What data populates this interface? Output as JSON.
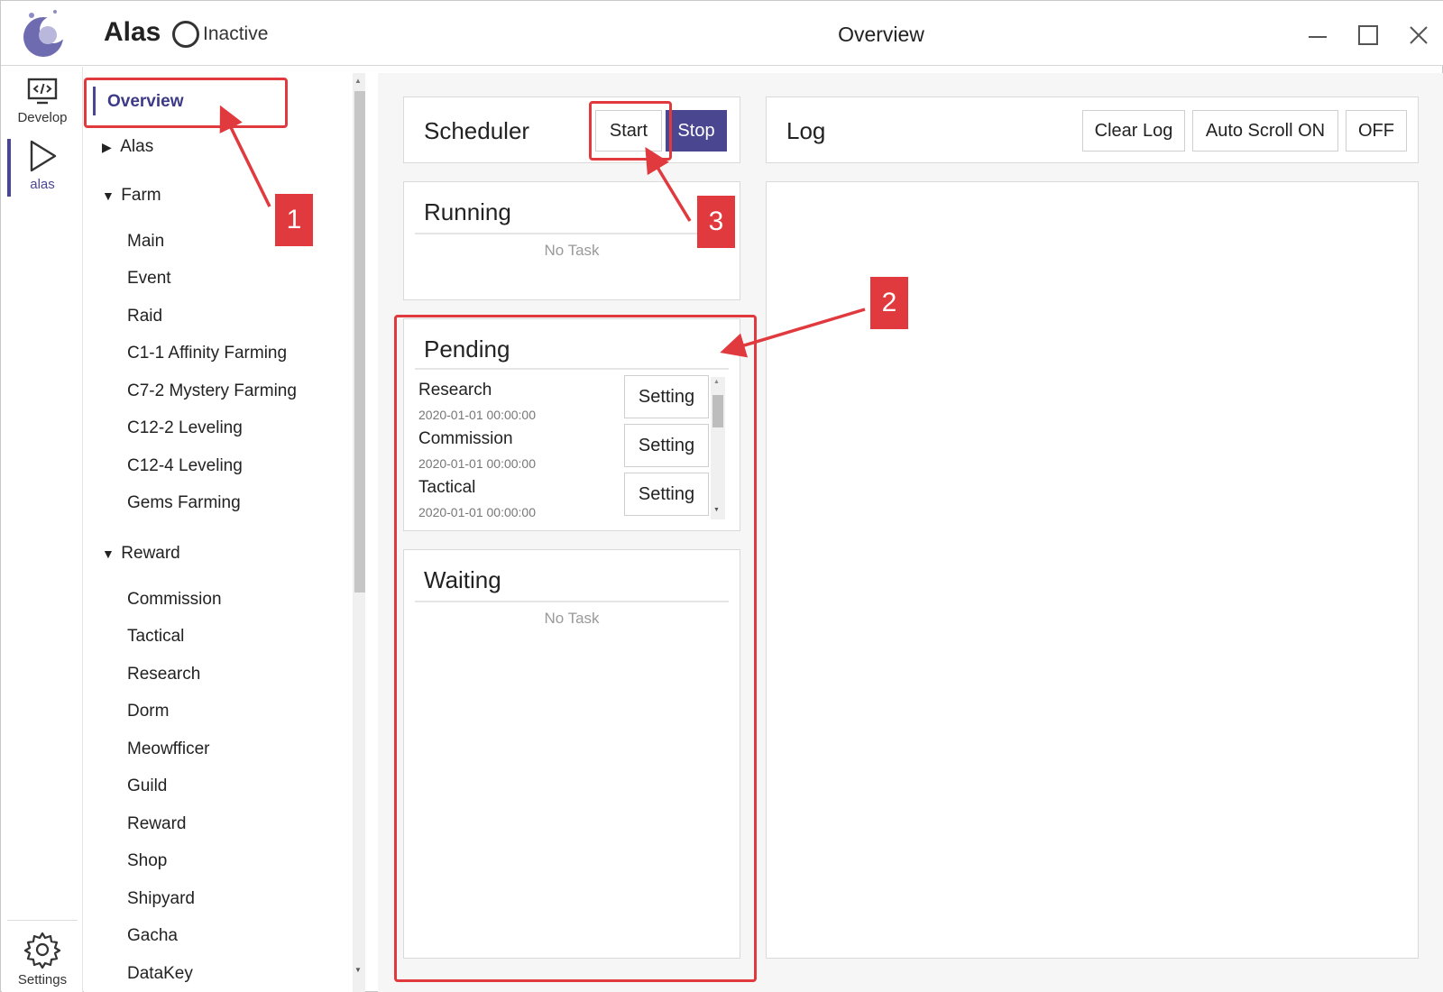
{
  "app": {
    "name": "Alas",
    "status": "Inactive",
    "window_title": "Overview"
  },
  "rail": {
    "develop": "Develop",
    "alas": "alas",
    "settings": "Settings"
  },
  "nav": {
    "overview": "Overview",
    "groups": [
      {
        "label": "Alas",
        "expanded": false
      },
      {
        "label": "Farm",
        "expanded": true
      },
      {
        "label": "Reward",
        "expanded": true
      }
    ],
    "farm_items": [
      "Main",
      "Event",
      "Raid",
      "C1-1 Affinity Farming",
      "C7-2 Mystery Farming",
      "C12-2 Leveling",
      "C12-4 Leveling",
      "Gems Farming"
    ],
    "reward_items": [
      "Commission",
      "Tactical",
      "Research",
      "Dorm",
      "Meowfficer",
      "Guild",
      "Reward",
      "Shop",
      "Shipyard",
      "Gacha",
      "DataKey"
    ]
  },
  "scheduler": {
    "title": "Scheduler",
    "start": "Start",
    "stop": "Stop"
  },
  "running": {
    "title": "Running",
    "empty": "No Task"
  },
  "pending": {
    "title": "Pending",
    "setting_label": "Setting",
    "tasks": [
      {
        "name": "Research",
        "time": "2020-01-01 00:00:00"
      },
      {
        "name": "Commission",
        "time": "2020-01-01 00:00:00"
      },
      {
        "name": "Tactical",
        "time": "2020-01-01 00:00:00"
      }
    ]
  },
  "waiting": {
    "title": "Waiting",
    "empty": "No Task"
  },
  "log": {
    "title": "Log",
    "clear": "Clear Log",
    "auto_scroll": "Auto Scroll ON",
    "off": "OFF"
  },
  "annotations": {
    "badge1": "1",
    "badge2": "2",
    "badge3": "3"
  },
  "colors": {
    "accent": "#4a4790",
    "annotation": "#e0393e"
  }
}
